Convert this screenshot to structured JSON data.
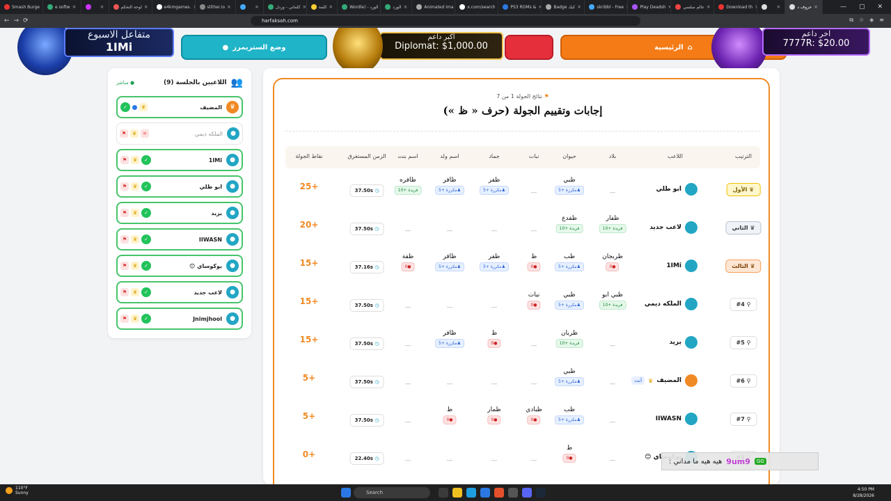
{
  "browser": {
    "tabs": [
      "Smash Burge",
      "e softw",
      "",
      "لوحة التحكم",
      "e4kmgames.",
      "slither.io",
      "",
      "كلماتي - وردل",
      "كلمة",
      "Wordle) - الورد",
      "الورد",
      "Animated ima",
      "x.com/search",
      "PS3 ROMs &",
      "Badge كيك",
      "skribbl - Free",
      "Play Deadsh",
      "عالم سلسي",
      "Download th",
      "",
      "حروف د"
    ],
    "active_tab": "حروف د",
    "url": "harfaksah.com"
  },
  "topbar": {
    "streamer_btn": "وضع الستريمرز",
    "home_btn": "الرئيسية"
  },
  "overlays": {
    "left_title": "متفاعل الاسبوع",
    "left_name": "1IMi",
    "center_title": "اكبر داعم",
    "center_value": "Diplomat: $1,000.00",
    "right_title": "اخر داعم",
    "right_value": "7777R: $20.00"
  },
  "sidebar": {
    "title": "اللاعبين بالجلسة (9)",
    "live": "مباشر",
    "players": [
      {
        "name": "المضيف",
        "host": true,
        "active": true
      },
      {
        "name": "الملكه ديمي",
        "host": false,
        "active": false
      },
      {
        "name": "1IMi",
        "host": false,
        "active": true
      },
      {
        "name": "ابو طلي",
        "host": false,
        "active": true
      },
      {
        "name": "يزيد",
        "host": false,
        "active": true
      },
      {
        "name": "IIWASN",
        "host": false,
        "active": true
      },
      {
        "name": "بوكوساي 😊",
        "host": false,
        "active": true
      },
      {
        "name": "لاعب جديد",
        "host": false,
        "active": true
      },
      {
        "name": "Jnimjhool",
        "host": false,
        "active": true
      }
    ]
  },
  "round": {
    "label": "نتائج الجولة 1 من 7",
    "title": "إجابات وتقييم الجولة (حرف « ظ »)",
    "headers": [
      "الترتيب",
      "اللاعب",
      "بلاد",
      "حيوان",
      "نبات",
      "جماد",
      "اسم ولد",
      "اسم بنت",
      "الزمن المستغرق",
      "نقاط الجولة"
    ],
    "rows": [
      {
        "rank": "الأول",
        "rank_style": "gold",
        "player": "ابو طلي",
        "answers": [
          null,
          [
            "ظبي",
            "dup",
            "مكررة +5"
          ],
          null,
          [
            "ظفر",
            "dup",
            "مكررة +5"
          ],
          [
            "ظافر",
            "dup",
            "مكررة +5"
          ],
          [
            "ظافره",
            "uni",
            "فريدة +10"
          ]
        ],
        "time": "37.50s",
        "points": "25+"
      },
      {
        "rank": "الثاني",
        "rank_style": "silver",
        "player": "لاعب جديد",
        "answers": [
          [
            "ظفار",
            "uni",
            "فريدة +10"
          ],
          [
            "ظفدع",
            "uni",
            "فريدة +10"
          ],
          null,
          null,
          null,
          null
        ],
        "time": "37.50s",
        "points": "20+"
      },
      {
        "rank": "الثالث",
        "rank_style": "bronze",
        "player": "1IMi",
        "answers": [
          [
            "ظربجان",
            "zero",
            "0"
          ],
          [
            "ظب",
            "dup",
            "مكررة +5"
          ],
          [
            "ظ",
            "zero",
            "0"
          ],
          [
            "ظفر",
            "dup",
            "مكررة +5"
          ],
          [
            "ظافر",
            "dup",
            "مكررة +5"
          ],
          [
            "ظفة",
            "zero",
            "0"
          ]
        ],
        "time": "37.16s",
        "points": "15+"
      },
      {
        "rank": "#4",
        "rank_style": "plain",
        "player": "الملكه ديمي",
        "answers": [
          [
            "ظبي ابو",
            "uni",
            "فريدة +10"
          ],
          [
            "ظبي",
            "dup",
            "مكررة +5"
          ],
          [
            "نبات",
            "zero",
            "0"
          ],
          null,
          null,
          null
        ],
        "time": "37.50s",
        "points": "15+"
      },
      {
        "rank": "#5",
        "rank_style": "plain",
        "player": "يزيد",
        "answers": [
          null,
          [
            "ظربان",
            "uni",
            "فريدة +10"
          ],
          null,
          [
            "ظ",
            "zero",
            "0"
          ],
          [
            "ظافر",
            "dup",
            "مكررة +5"
          ],
          null
        ],
        "time": "37.50s",
        "points": "15+"
      },
      {
        "rank": "#6",
        "rank_style": "plain",
        "player": "المضيف",
        "you": "أنت",
        "answers": [
          null,
          [
            "ظبي",
            "dup",
            "مكررة +5"
          ],
          null,
          null,
          null,
          null
        ],
        "time": "37.50s",
        "points": "5+"
      },
      {
        "rank": "#7",
        "rank_style": "plain",
        "player": "IIWASN",
        "answers": [
          null,
          [
            "ظب",
            "dup",
            "مكررة +5"
          ],
          [
            "ظبادي",
            "zero",
            "0"
          ],
          [
            "ظمار",
            "zero",
            "0"
          ],
          [
            "ظ",
            "zero",
            "0"
          ],
          null
        ],
        "time": "37.50s",
        "points": "5+"
      },
      {
        "rank": "#8",
        "rank_style": "plain",
        "player": "بوكوساي 😊",
        "answers": [
          null,
          [
            "ظ",
            "zero",
            "0"
          ],
          null,
          null,
          null,
          null
        ],
        "time": "22.40s",
        "points": "0+"
      }
    ]
  },
  "chat": {
    "user": "9um9",
    "tag": "GG",
    "message": "هيه هيه ما مداني :"
  },
  "taskbar": {
    "temp": "110°F",
    "weather": "Sunny",
    "search": "Search",
    "time": "4:50 PM",
    "date": "8/28/2026"
  }
}
